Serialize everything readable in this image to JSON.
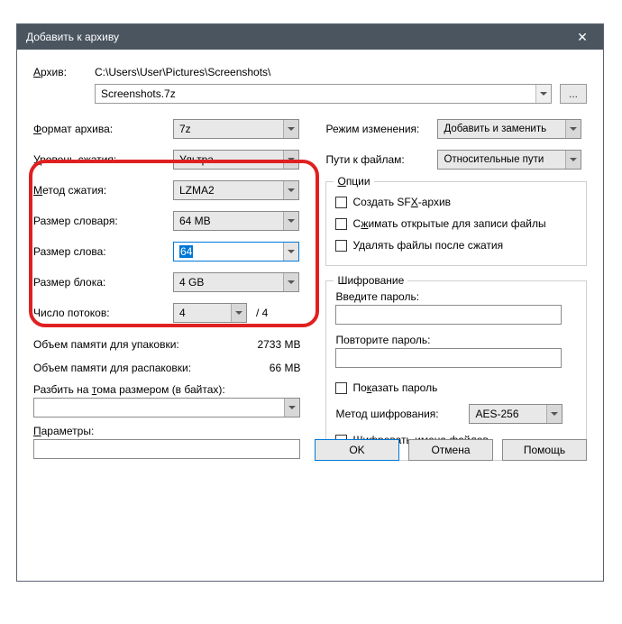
{
  "titlebar": {
    "text": "Добавить к архиву"
  },
  "archive": {
    "label": "Архив:",
    "path": "C:\\Users\\User\\Pictures\\Screenshots\\",
    "filename": "Screenshots.7z",
    "browse": "..."
  },
  "left": {
    "format_label": "Формат архива:",
    "format_value": "7z",
    "level_label": "Уровень сжатия:",
    "level_value": "Ультра",
    "method_label": "Метод сжатия:",
    "method_value": "LZMA2",
    "dict_label": "Размер словаря:",
    "dict_value": "64 MB",
    "word_label": "Размер слова:",
    "word_value": "64",
    "block_label": "Размер блока:",
    "block_value": "4 GB",
    "threads_label": "Число потоков:",
    "threads_value": "4",
    "threads_max": "/ 4",
    "mem_pack_label": "Объем памяти для упаковки:",
    "mem_pack_value": "2733 MB",
    "mem_unpack_label": "Объем памяти для распаковки:",
    "mem_unpack_value": "66 MB",
    "split_label": "Разбить на тома размером (в байтах):",
    "params_label": "Параметры:"
  },
  "right": {
    "mode_label": "Режим изменения:",
    "mode_value": "Добавить и заменить",
    "paths_label": "Пути к файлам:",
    "paths_value": "Относительные пути",
    "options_title": "Опции",
    "opt_sfx": "Создать SFX-архив",
    "opt_shared": "Сжимать открытые для записи файлы",
    "opt_delete": "Удалять файлы после сжатия",
    "enc_title": "Шифрование",
    "pwd1_label": "Введите пароль:",
    "pwd2_label": "Повторите пароль:",
    "show_pwd": "Показать пароль",
    "enc_method_label": "Метод шифрования:",
    "enc_method_value": "AES-256",
    "enc_names": "Шифровать имена файлов"
  },
  "buttons": {
    "ok": "OK",
    "cancel": "Отмена",
    "help": "Помощь"
  }
}
